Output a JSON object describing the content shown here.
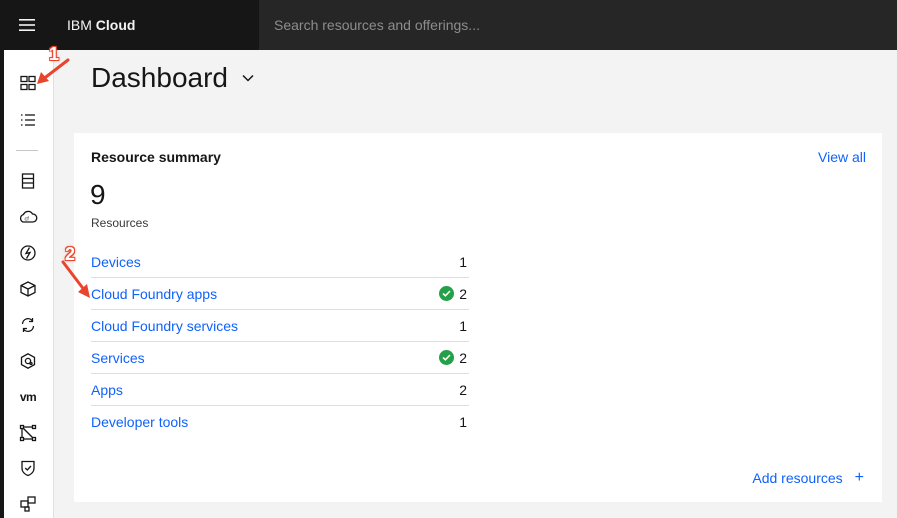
{
  "header": {
    "brand_prefix": "IBM",
    "brand_name": "Cloud",
    "search_placeholder": "Search resources and offerings..."
  },
  "rail": {
    "vm_label": "vm",
    "icons": [
      "dashboard-icon",
      "resource-list-icon",
      "classic-infrastructure-icon",
      "cloud-foundry-icon",
      "functions-icon",
      "kubernetes-icon",
      "devops-icon",
      "openshift-icon",
      "vmware-icon",
      "interconnectivity-icon",
      "security-icon",
      "watson-icon"
    ]
  },
  "page": {
    "title": "Dashboard"
  },
  "resource_summary": {
    "title": "Resource summary",
    "view_all": "View all",
    "total": "9",
    "total_label": "Resources",
    "rows": [
      {
        "label": "Devices",
        "count": "1",
        "ok": false
      },
      {
        "label": "Cloud Foundry apps",
        "count": "2",
        "ok": true
      },
      {
        "label": "Cloud Foundry services",
        "count": "1",
        "ok": false
      },
      {
        "label": "Services",
        "count": "2",
        "ok": true
      },
      {
        "label": "Apps",
        "count": "2",
        "ok": false
      },
      {
        "label": "Developer tools",
        "count": "1",
        "ok": false
      }
    ],
    "add_resources": "Add resources",
    "add_symbol": "+"
  },
  "annotations": {
    "first": "1",
    "second": "2"
  },
  "colors": {
    "link": "#0f62fe",
    "success": "#24a148",
    "header_bg": "#161616",
    "annotation": "#e8452c"
  }
}
